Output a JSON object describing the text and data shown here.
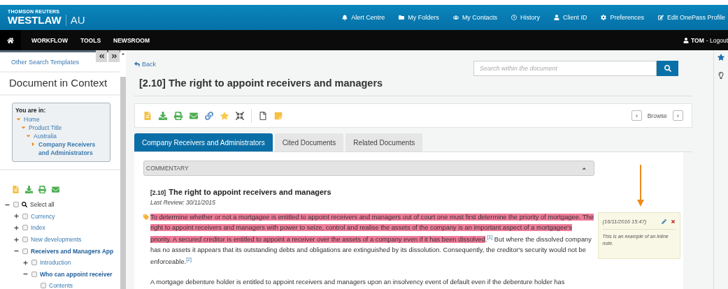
{
  "header": {
    "brand_top": "THOMSON REUTERS",
    "brand": "WESTLAW",
    "region": "AU",
    "links": [
      "Alert Centre",
      "My Folders",
      "My Contacts",
      "History",
      "Client ID",
      "Preferences",
      "Edit OnePass Profile"
    ]
  },
  "nav": {
    "items": [
      "WORKFLOW",
      "TOOLS",
      "NEWSROOM"
    ],
    "user": "TOM",
    "logout": "- Logout"
  },
  "sidebar": {
    "templates_link": "Other Search Templates",
    "title": "Document in Context",
    "context": {
      "heading": "You are in:",
      "path": [
        {
          "label": "Home",
          "current": false,
          "children": [
            {
              "label": "Product Title",
              "current": false,
              "children": [
                {
                  "label": "Australia",
                  "current": false,
                  "children": [
                    {
                      "label": "Company Receivers and Administrators",
                      "current": true
                    }
                  ]
                }
              ]
            }
          ]
        }
      ]
    },
    "tree": [
      {
        "label": "Select all",
        "kind": "root",
        "expanded": true,
        "checked": false,
        "children": [
          {
            "label": "Currency",
            "kind": "branch",
            "expanded": false,
            "checked": false
          },
          {
            "label": "Index",
            "kind": "branch",
            "expanded": false,
            "checked": false
          },
          {
            "label": "New developments",
            "kind": "branch",
            "expanded": false,
            "checked": false
          },
          {
            "label": "Receivers and Managers App",
            "kind": "branch",
            "expanded": true,
            "checked": false,
            "children": [
              {
                "label": "Introduction",
                "kind": "branch",
                "expanded": false,
                "checked": false
              },
              {
                "label": "Who can appoint receiver",
                "kind": "branch",
                "expanded": true,
                "checked": false,
                "children": [
                  {
                    "label": "Contents",
                    "kind": "leaf",
                    "checked": false
                  }
                ]
              }
            ]
          }
        ]
      }
    ]
  },
  "main": {
    "back": "Back",
    "title": "[2.10] The right to appoint receivers and managers",
    "search": {
      "placeholder": "Search within the document"
    },
    "browse": "Browse",
    "tabs": [
      {
        "label": "Company Receivers and Administrators",
        "selected": true
      },
      {
        "label": "Cited Documents",
        "selected": false
      },
      {
        "label": "Related Documents",
        "selected": false
      }
    ],
    "section": {
      "label": "COMMENTARY",
      "expanded": true
    },
    "article": {
      "number": "[2.10]",
      "heading": "The right to appoint receivers and managers",
      "review": "Last Review: 30/11/2015",
      "paragraphs": [
        {
          "annotated": true,
          "segments": [
            {
              "kind": "highlight",
              "text": "To determine whether or not a mortgagee is entitled to appoint receivers and managers out of court one must first determine the priority of mortgagee. The right to appoint receivers and managers with power to seize, control and realise the assets of the company is an important aspect of a mortgagee's priority. A secured creditor is entitled to appoint a receiver over the assets of a company even if it has been dissolved"
            },
            {
              "kind": "text",
              "text": "."
            },
            {
              "kind": "footnote",
              "text": "[1]"
            },
            {
              "kind": "text",
              "text": "  But where the dissolved company has no assets it appears that its outstanding debts and obligations are extinguished by its dissolution. Consequently, the creditor's security would not be enforceable."
            },
            {
              "kind": "footnote",
              "text": "[2]"
            }
          ]
        },
        {
          "annotated": false,
          "segments": [
            {
              "kind": "text",
              "text": "A mortgage debenture holder is entitled to appoint receivers and managers upon an insolvency event of default even if the debenture holder has"
            }
          ]
        }
      ]
    },
    "note": {
      "date": "(16/11/2016 15:47)",
      "text": "This is an example of an inline note."
    }
  }
}
